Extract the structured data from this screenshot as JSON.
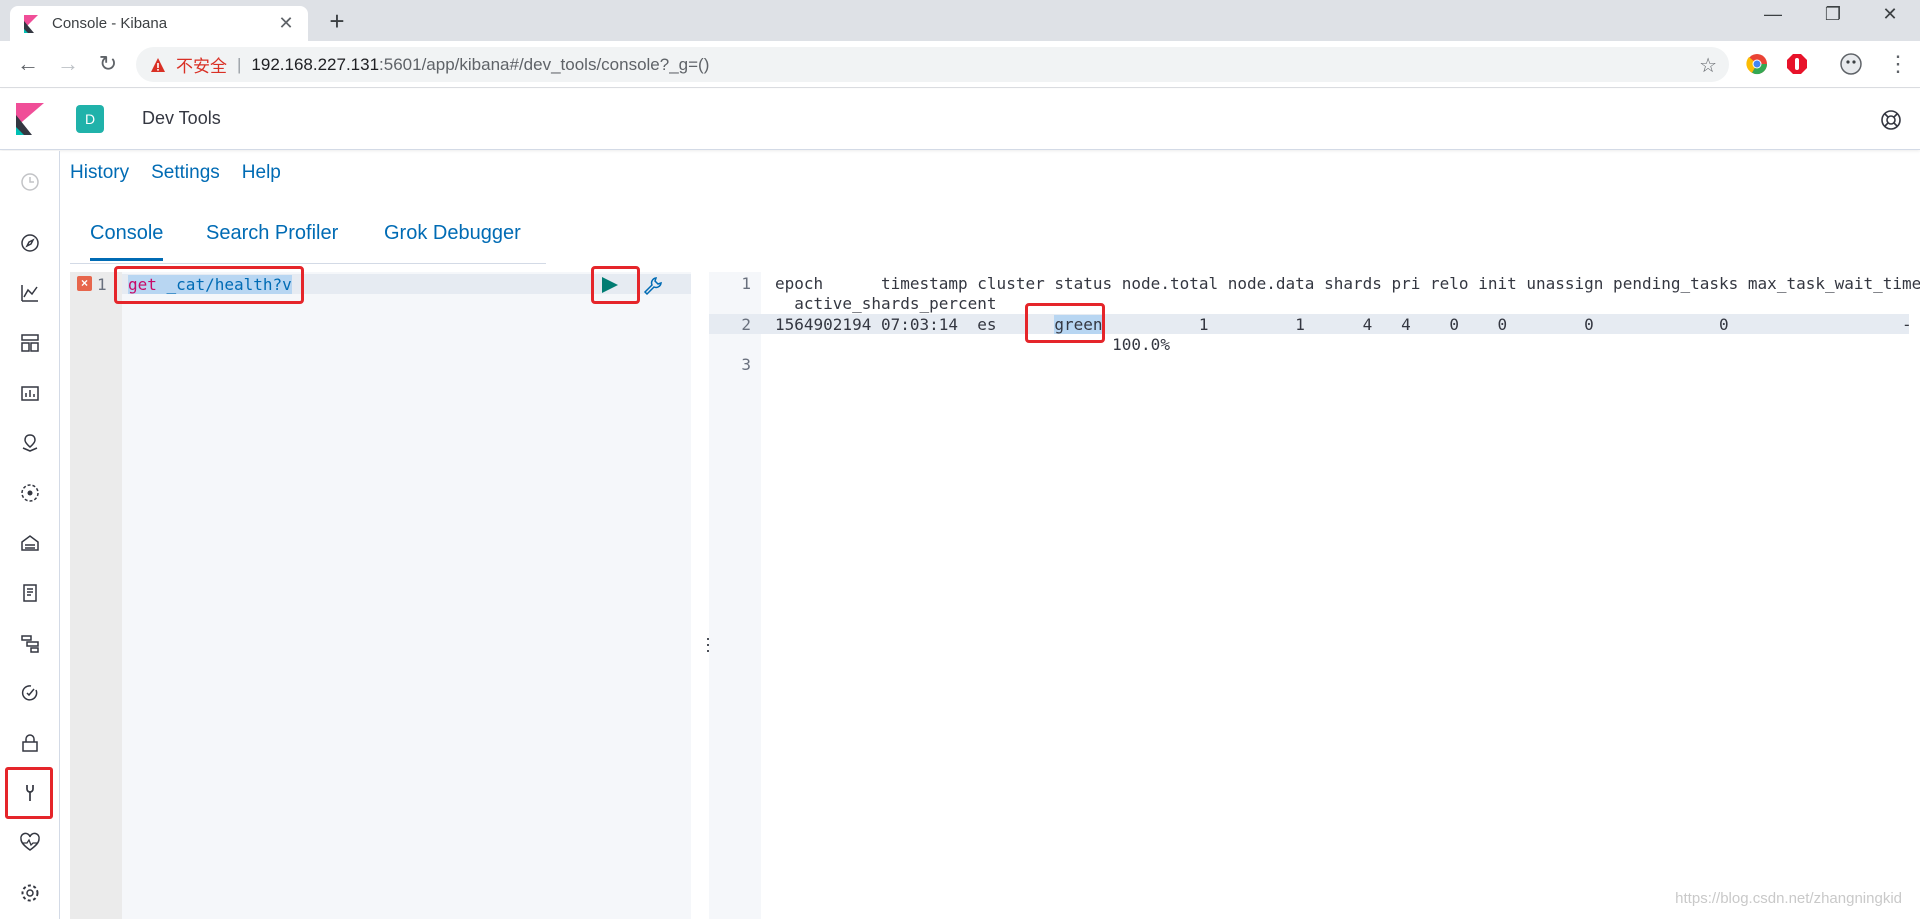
{
  "browser": {
    "tab_title": "Console - Kibana",
    "tab_close": "✕",
    "new_tab": "+",
    "window_controls": [
      "—",
      "❐",
      "✕"
    ],
    "nav": {
      "back": "←",
      "forward": "→",
      "reload": "↻"
    },
    "address": {
      "security_label": "不安全",
      "separator": "|",
      "host": "192.168.227.131",
      "path": ":5601/app/kibana#/dev_tools/console?_g=()"
    },
    "bookmark_star": "☆"
  },
  "kibana": {
    "space_initial": "D",
    "app_title": "Dev Tools",
    "top_links": [
      "History",
      "Settings",
      "Help"
    ],
    "tabs": [
      "Console",
      "Search Profiler",
      "Grok Debugger"
    ],
    "left_nav_icons": [
      "recent-icon",
      "discover-icon",
      "visualize-icon",
      "dashboard-icon",
      "canvas-icon",
      "maps-icon",
      "ml-icon",
      "infrastructure-icon",
      "logs-icon",
      "apm-icon",
      "uptime-icon",
      "security-icon",
      "dev-tools-icon",
      "monitoring-icon",
      "management-icon"
    ]
  },
  "request_editor": {
    "line_number": "1",
    "error_marker": "×",
    "method": "get",
    "path": " _cat/health?v"
  },
  "response_editor": {
    "lines": [
      {
        "n": "1",
        "text": "epoch      timestamp cluster status node.total node.data shards pri relo init unassign pending_tasks max_task_wait_time"
      },
      {
        "n": "",
        "text": "  active_shards_percent"
      },
      {
        "n": "2",
        "pre": "1564902194 07:03:14  es      ",
        "status": "green",
        "post": "          1         1      4   4    0    0        0             0                  -"
      },
      {
        "n": "",
        "text": "                                   100.0%"
      },
      {
        "n": "3",
        "text": ""
      }
    ]
  },
  "watermark": "https://blog.csdn.net/zhangningkid"
}
